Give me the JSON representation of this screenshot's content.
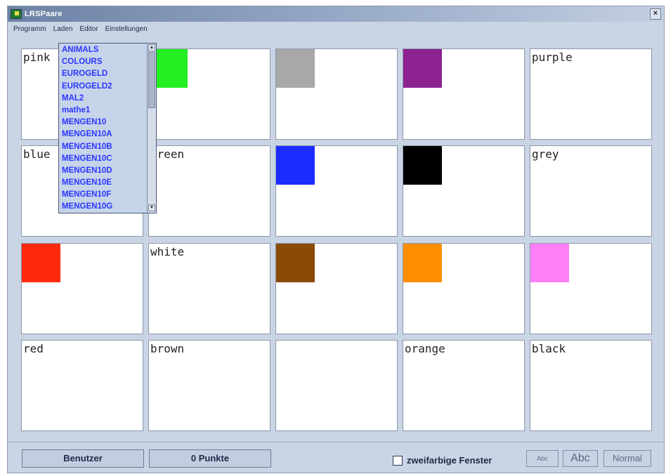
{
  "window": {
    "title": "LRSPaare",
    "close": "×"
  },
  "menu": [
    "Programm",
    "Laden",
    "Editor",
    "Einstellungen"
  ],
  "tiles": [
    {
      "label": "pink",
      "color": ""
    },
    {
      "label": "",
      "color": "#22ee22"
    },
    {
      "label": "",
      "color": "#a8a8a8"
    },
    {
      "label": "",
      "color": "#8c2390"
    },
    {
      "label": "purple",
      "color": ""
    },
    {
      "label": "blue",
      "color": ""
    },
    {
      "label": "green",
      "color": ""
    },
    {
      "label": "",
      "color": "#1c2cff"
    },
    {
      "label": "",
      "color": "#000000"
    },
    {
      "label": "grey",
      "color": ""
    },
    {
      "label": "",
      "color": "#ff2a0d"
    },
    {
      "label": "white",
      "color": ""
    },
    {
      "label": "",
      "color": "#8b4a06"
    },
    {
      "label": "",
      "color": "#ff8f00"
    },
    {
      "label": "",
      "color": "#ff80f6"
    },
    {
      "label": "red",
      "color": ""
    },
    {
      "label": "brown",
      "color": ""
    },
    {
      "label": "",
      "color": ""
    },
    {
      "label": "orange",
      "color": ""
    },
    {
      "label": "black",
      "color": ""
    }
  ],
  "dropdown": {
    "items": [
      "ANIMALS",
      "COLOURS",
      "EUROGELD",
      "EUROGELD2",
      "MAL2",
      "mathe1",
      "MENGEN10",
      "MENGEN10A",
      "MENGEN10B",
      "MENGEN10C",
      "MENGEN10D",
      "MENGEN10E",
      "MENGEN10F",
      "MENGEN10G"
    ],
    "up_arrow": "▲",
    "down_arrow": "▼"
  },
  "bottom": {
    "user_button": "Benutzer",
    "points_button": "0 Punkte",
    "two_color_label": "zweifarbige Fenster",
    "two_color_checked": false,
    "font_small": "Abc",
    "font_large": "Abc",
    "normal_button": "Normal"
  }
}
